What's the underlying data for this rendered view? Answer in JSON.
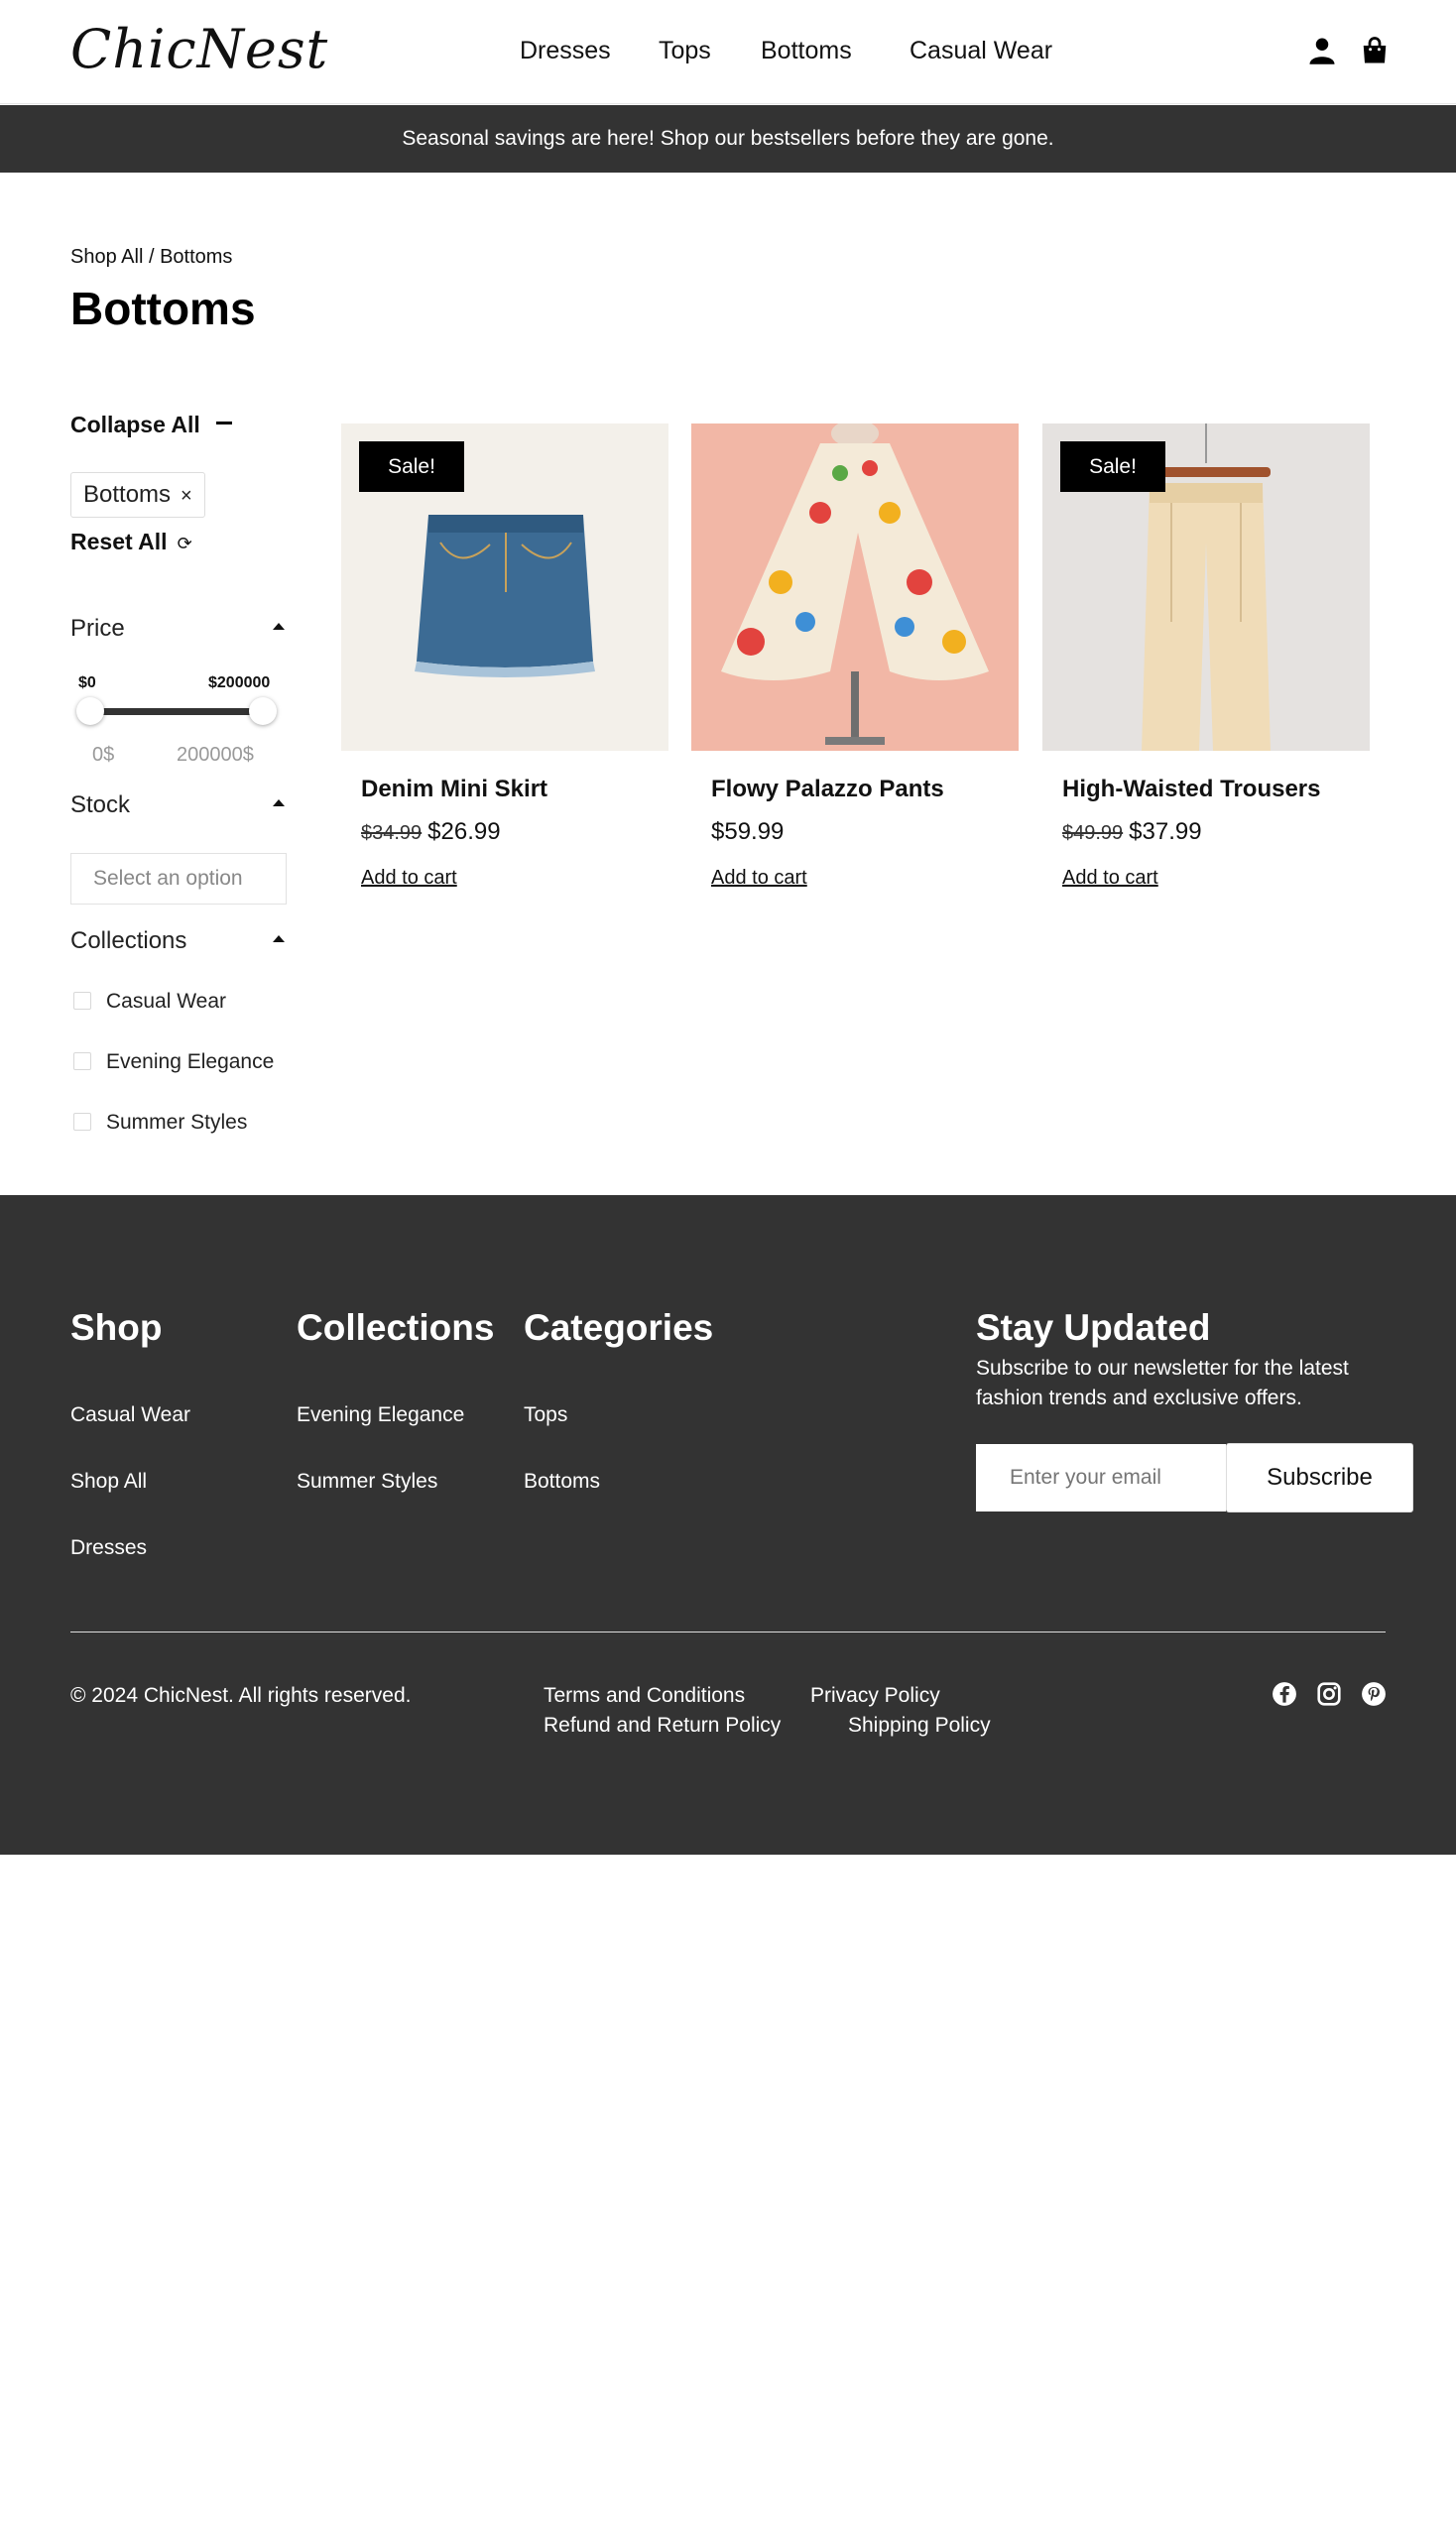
{
  "brand": {
    "logo": "ChicNest"
  },
  "nav": {
    "items": [
      "Dresses",
      "Tops",
      "Bottoms",
      "Casual Wear"
    ],
    "account_icon": "user-icon",
    "cart_icon": "shopping-bag-icon"
  },
  "announcement": "Seasonal savings are here! Shop our bestsellers before they are gone.",
  "breadcrumb": {
    "root": "Shop All",
    "separator": " / ",
    "current": "Bottoms"
  },
  "page_title": "Bottoms",
  "filters": {
    "collapse_all": "Collapse All",
    "active_chip": "Bottoms",
    "chip_remove": "×",
    "reset_all": "Reset All",
    "reset_icon": "⟳",
    "price": {
      "label": "Price",
      "min_label": "$0",
      "max_label": "$200000",
      "min_value": "0$",
      "max_value": "200000$"
    },
    "stock": {
      "label": "Stock",
      "placeholder": "Select an option"
    },
    "collections": {
      "label": "Collections",
      "options": [
        "Casual Wear",
        "Evening Elegance",
        "Summer Styles"
      ]
    }
  },
  "products": [
    {
      "name": "Denim Mini Skirt",
      "old_price": "$34.99",
      "price": "$26.99",
      "badge": "Sale!",
      "cta": "Add to cart"
    },
    {
      "name": "Flowy Palazzo Pants",
      "old_price": "",
      "price": "$59.99",
      "badge": "",
      "cta": "Add to cart"
    },
    {
      "name": "High-Waisted Trousers",
      "old_price": "$49.99",
      "price": "$37.99",
      "badge": "Sale!",
      "cta": "Add to cart"
    }
  ],
  "footer": {
    "shop": {
      "heading": "Shop",
      "links": [
        "Casual Wear",
        "Shop All",
        "Dresses"
      ]
    },
    "collections": {
      "heading": "Collections",
      "links": [
        "Evening Elegance",
        "Summer Styles"
      ]
    },
    "categories": {
      "heading": "Categories",
      "links": [
        "Tops",
        "Bottoms"
      ]
    },
    "newsletter": {
      "heading": "Stay Updated",
      "description": "Subscribe to our newsletter for the latest fashion trends and exclusive offers.",
      "placeholder": "Enter your email",
      "button": "Subscribe"
    },
    "copyright": "© 2024 ChicNest. All rights reserved.",
    "legal": [
      "Terms and Conditions",
      "Privacy Policy",
      "Refund and Return Policy",
      "Shipping Policy"
    ],
    "social": [
      "facebook-icon",
      "instagram-icon",
      "pinterest-icon"
    ]
  },
  "colors": {
    "dark": "#333333",
    "background": "#ffffff",
    "accent": "#000000"
  }
}
